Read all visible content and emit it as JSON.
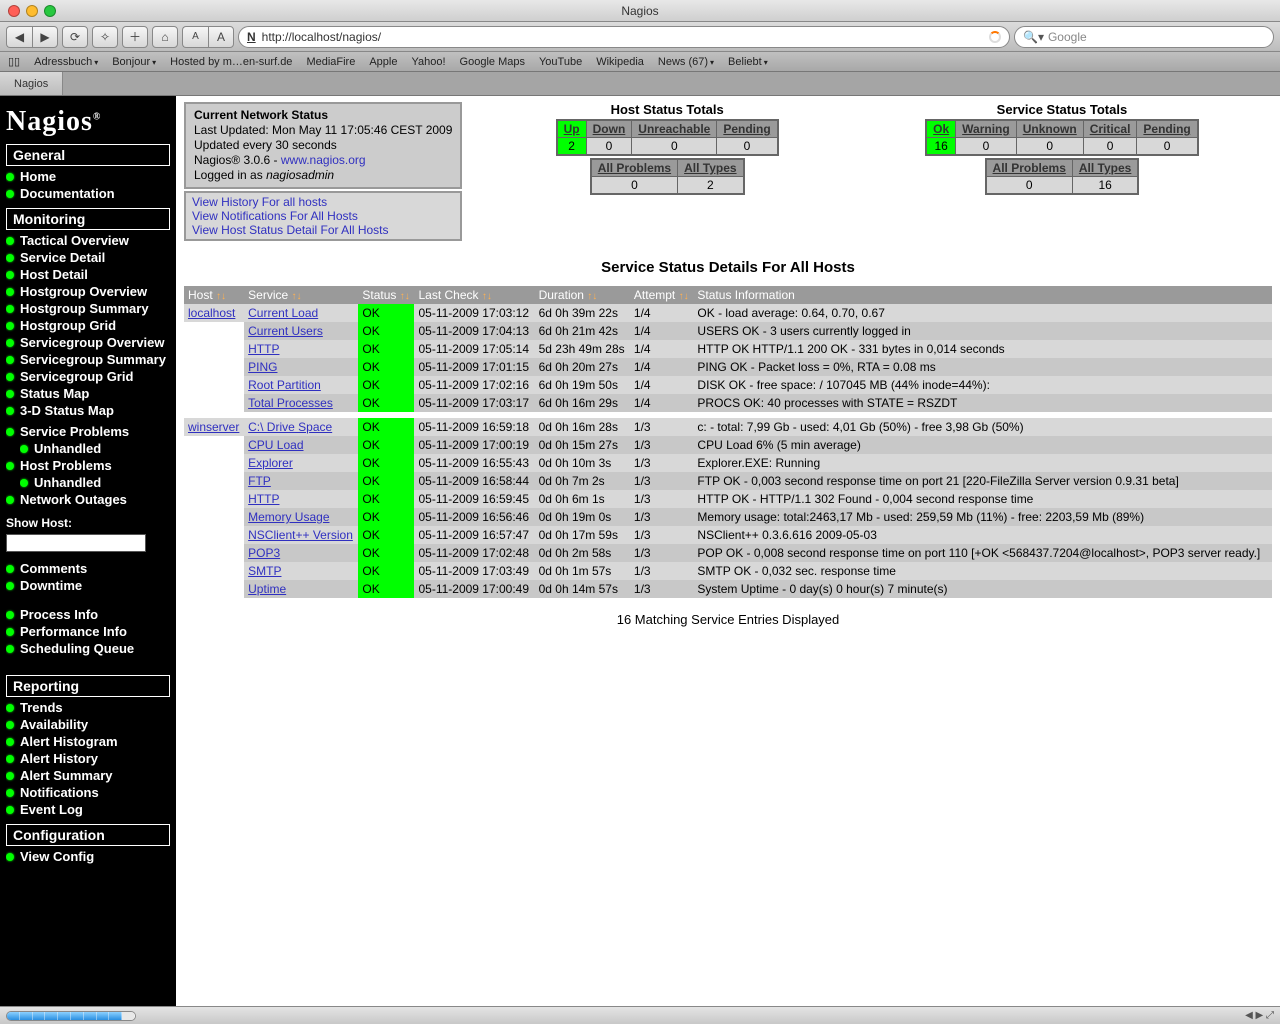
{
  "window": {
    "title": "Nagios"
  },
  "browser": {
    "url": "http://localhost/nagios/",
    "search_placeholder": "Google",
    "bookmarks": [
      "Adressbuch",
      "Bonjour",
      "Hosted by m…en-surf.de",
      "MediaFire",
      "Apple",
      "Yahoo!",
      "Google Maps",
      "YouTube",
      "Wikipedia",
      "News (67)",
      "Beliebt"
    ],
    "tab": "Nagios"
  },
  "sidebar": {
    "logo": "Nagios",
    "sections": [
      {
        "title": "General",
        "items": [
          "Home",
          "Documentation"
        ]
      },
      {
        "title": "Monitoring",
        "items": [
          "Tactical Overview",
          "Service Detail",
          "Host Detail",
          "Hostgroup Overview",
          "Hostgroup Summary",
          "Hostgroup Grid",
          "Servicegroup Overview",
          "Servicegroup Summary",
          "Servicegroup Grid",
          "Status Map",
          "3-D Status Map"
        ]
      },
      {
        "title": "",
        "items": [
          "Service Problems",
          "Unhandled",
          "Host Problems",
          "Unhandled",
          "Network Outages"
        ]
      },
      {
        "title": "",
        "items": [
          "Comments",
          "Downtime"
        ]
      },
      {
        "title": "",
        "items": [
          "Process Info",
          "Performance Info",
          "Scheduling Queue"
        ]
      },
      {
        "title": "Reporting",
        "items": [
          "Trends",
          "Availability",
          "Alert Histogram",
          "Alert History",
          "Alert Summary",
          "Notifications",
          "Event Log"
        ]
      },
      {
        "title": "Configuration",
        "items": [
          "View Config"
        ]
      }
    ],
    "showhost_label": "Show Host:"
  },
  "status": {
    "title": "Current Network Status",
    "updated": "Last Updated: Mon May 11 17:05:46 CEST 2009",
    "interval": "Updated every 30 seconds",
    "version_pre": "Nagios® 3.0.6 - ",
    "version_link": "www.nagios.org",
    "logged_pre": "Logged in as ",
    "logged_user": "nagiosadmin",
    "links": [
      "View History For all hosts",
      "View Notifications For All Hosts",
      "View Host Status Detail For All Hosts"
    ]
  },
  "host_totals": {
    "title": "Host Status Totals",
    "headers": [
      "Up",
      "Down",
      "Unreachable",
      "Pending"
    ],
    "values": [
      "2",
      "0",
      "0",
      "0"
    ],
    "sub_headers": [
      "All Problems",
      "All Types"
    ],
    "sub_values": [
      "0",
      "2"
    ]
  },
  "service_totals": {
    "title": "Service Status Totals",
    "headers": [
      "Ok",
      "Warning",
      "Unknown",
      "Critical",
      "Pending"
    ],
    "values": [
      "16",
      "0",
      "0",
      "0",
      "0"
    ],
    "sub_headers": [
      "All Problems",
      "All Types"
    ],
    "sub_values": [
      "0",
      "16"
    ]
  },
  "details_title": "Service Status Details For All Hosts",
  "columns": [
    "Host",
    "Service",
    "Status",
    "Last Check",
    "Duration",
    "Attempt",
    "Status Information"
  ],
  "services": [
    {
      "host": "localhost",
      "svc": "Current Load",
      "st": "OK",
      "lc": "05-11-2009 17:03:12",
      "dur": "6d 0h 39m 22s",
      "att": "1/4",
      "info": "OK - load average: 0.64, 0.70, 0.67"
    },
    {
      "host": "",
      "svc": "Current Users",
      "st": "OK",
      "lc": "05-11-2009 17:04:13",
      "dur": "6d 0h 21m 42s",
      "att": "1/4",
      "info": "USERS OK - 3 users currently logged in"
    },
    {
      "host": "",
      "svc": "HTTP",
      "st": "OK",
      "lc": "05-11-2009 17:05:14",
      "dur": "5d 23h 49m 28s",
      "att": "1/4",
      "info": "HTTP OK HTTP/1.1 200 OK - 331 bytes in 0,014 seconds"
    },
    {
      "host": "",
      "svc": "PING",
      "st": "OK",
      "lc": "05-11-2009 17:01:15",
      "dur": "6d 0h 20m 27s",
      "att": "1/4",
      "info": "PING OK - Packet loss = 0%, RTA = 0.08 ms"
    },
    {
      "host": "",
      "svc": "Root Partition",
      "st": "OK",
      "lc": "05-11-2009 17:02:16",
      "dur": "6d 0h 19m 50s",
      "att": "1/4",
      "info": "DISK OK - free space: / 107045 MB (44% inode=44%):"
    },
    {
      "host": "",
      "svc": "Total Processes",
      "st": "OK",
      "lc": "05-11-2009 17:03:17",
      "dur": "6d 0h 16m 29s",
      "att": "1/4",
      "info": "PROCS OK: 40 processes with STATE = RSZDT"
    },
    {
      "host": "winserver",
      "svc": "C:\\ Drive Space",
      "st": "OK",
      "lc": "05-11-2009 16:59:18",
      "dur": "0d 0h 16m 28s",
      "att": "1/3",
      "info": "c: - total: 7,99 Gb - used: 4,01 Gb (50%) - free 3,98 Gb (50%)"
    },
    {
      "host": "",
      "svc": "CPU Load",
      "st": "OK",
      "lc": "05-11-2009 17:00:19",
      "dur": "0d 0h 15m 27s",
      "att": "1/3",
      "info": "CPU Load 6% (5 min average)"
    },
    {
      "host": "",
      "svc": "Explorer",
      "st": "OK",
      "lc": "05-11-2009 16:55:43",
      "dur": "0d 0h 10m 3s",
      "att": "1/3",
      "info": "Explorer.EXE: Running"
    },
    {
      "host": "",
      "svc": "FTP",
      "st": "OK",
      "lc": "05-11-2009 16:58:44",
      "dur": "0d 0h 7m 2s",
      "att": "1/3",
      "info": "FTP OK - 0,003 second response time on port 21 [220-FileZilla Server version 0.9.31 beta]"
    },
    {
      "host": "",
      "svc": "HTTP",
      "st": "OK",
      "lc": "05-11-2009 16:59:45",
      "dur": "0d 0h 6m 1s",
      "att": "1/3",
      "info": "HTTP OK - HTTP/1.1 302 Found - 0,004 second response time"
    },
    {
      "host": "",
      "svc": "Memory Usage",
      "st": "OK",
      "lc": "05-11-2009 16:56:46",
      "dur": "0d 0h 19m 0s",
      "att": "1/3",
      "info": "Memory usage: total:2463,17 Mb - used: 259,59 Mb (11%) - free: 2203,59 Mb (89%)"
    },
    {
      "host": "",
      "svc": "NSClient++ Version",
      "st": "OK",
      "lc": "05-11-2009 16:57:47",
      "dur": "0d 0h 17m 59s",
      "att": "1/3",
      "info": "NSClient++ 0.3.6.616 2009-05-03"
    },
    {
      "host": "",
      "svc": "POP3",
      "st": "OK",
      "lc": "05-11-2009 17:02:48",
      "dur": "0d 0h 2m 58s",
      "att": "1/3",
      "info": "POP OK - 0,008 second response time on port 110 [+OK <568437.7204@localhost>, POP3 server ready.]"
    },
    {
      "host": "",
      "svc": "SMTP",
      "st": "OK",
      "lc": "05-11-2009 17:03:49",
      "dur": "0d 0h 1m 57s",
      "att": "1/3",
      "info": "SMTP OK - 0,032 sec. response time"
    },
    {
      "host": "",
      "svc": "Uptime",
      "st": "OK",
      "lc": "05-11-2009 17:00:49",
      "dur": "0d 0h 14m 57s",
      "att": "1/3",
      "info": "System Uptime - 0 day(s) 0 hour(s) 7 minute(s)"
    }
  ],
  "matching": "16 Matching Service Entries Displayed"
}
